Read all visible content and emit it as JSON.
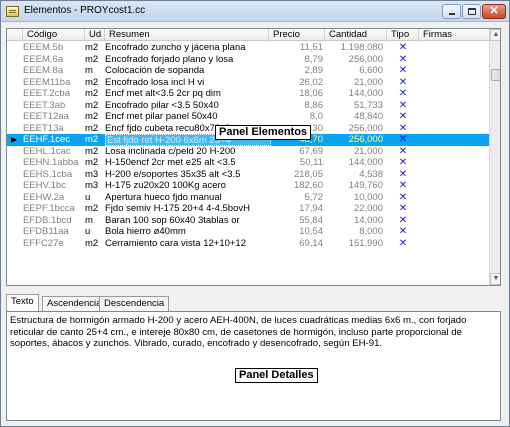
{
  "window": {
    "title": "Elementos - PROYcost1.cc",
    "icon": "document-list-icon"
  },
  "grid": {
    "columns": [
      "Código",
      "Ud",
      "Resumen",
      "Precio",
      "Cantidad",
      "Tipo",
      "Firmas"
    ],
    "rows": [
      {
        "code": "EEEM.5b",
        "ud": "m2",
        "resumen": "Encofrado zuncho y jácena plana",
        "precio": "11,51",
        "cantidad": "1.198,080",
        "tipo": "✕"
      },
      {
        "code": "EEEM.6a",
        "ud": "m2",
        "resumen": "Encofrado forjado plano y losa",
        "precio": "8,79",
        "cantidad": "256,000",
        "tipo": "✕"
      },
      {
        "code": "EEEM.8a",
        "ud": "m",
        "resumen": "Colocación de sopanda",
        "precio": "2,89",
        "cantidad": "6,600",
        "tipo": "✕"
      },
      {
        "code": "EEEM11ba",
        "ud": "m2",
        "resumen": "Encofrado losa incl H vi",
        "precio": "26,02",
        "cantidad": "21,000",
        "tipo": "✕"
      },
      {
        "code": "EEET.2cba",
        "ud": "m2",
        "resumen": "Encf met alt<3.5 2cr pq dim",
        "precio": "18,06",
        "cantidad": "144,000",
        "tipo": "✕"
      },
      {
        "code": "EEET.3ab",
        "ud": "m2",
        "resumen": "Encofrado pilar <3.5 50x40",
        "precio": "8,86",
        "cantidad": "51,733",
        "tipo": "✕"
      },
      {
        "code": "EEET12aa",
        "ud": "m2",
        "resumen": "Encf met pilar panel 50x40",
        "precio": "8,0",
        "cantidad": "48,840",
        "tipo": "✕"
      },
      {
        "code": "EEET13a",
        "ud": "m2",
        "resumen": "Encf fjdo cubeta recu80x76x2",
        "precio": "30",
        "cantidad": "256,000",
        "tipo": "✕"
      },
      {
        "code": "EEHF.1cec",
        "ud": "m2",
        "resumen": "Est fjdo ret H-200 6x6m 25+4",
        "precio": "43,70",
        "cantidad": "256,000",
        "tipo": "✕",
        "selected": true
      },
      {
        "code": "EEHL.1cac",
        "ud": "m2",
        "resumen": "Losa inclinada c/peld 20 H-200",
        "precio": "67,69",
        "cantidad": "21,000",
        "tipo": "✕"
      },
      {
        "code": "EEHN.1abba",
        "ud": "m2",
        "resumen": "H-150encf 2cr met e25 alt <3.5",
        "precio": "50,11",
        "cantidad": "144,000",
        "tipo": "✕"
      },
      {
        "code": "EEHS.1cba",
        "ud": "m3",
        "resumen": "H-200 e/soportes 35x35 alt <3.5",
        "precio": "218,05",
        "cantidad": "4,538",
        "tipo": "✕"
      },
      {
        "code": "EEHV.1bc",
        "ud": "m3",
        "resumen": "H-175 zu20x20 100Kg acero",
        "precio": "182,60",
        "cantidad": "149,760",
        "tipo": "✕"
      },
      {
        "code": "EEHW.2a",
        "ud": "u",
        "resumen": "Apertura hueco fjdo manual",
        "precio": "5,72",
        "cantidad": "10,000",
        "tipo": "✕"
      },
      {
        "code": "EEPF.1bcca",
        "ud": "m2",
        "resumen": "Fjdo semiv H-175 20+4 4-4.5bovH",
        "precio": "17,94",
        "cantidad": "22,000",
        "tipo": "✕"
      },
      {
        "code": "EFDB.1bcd",
        "ud": "m",
        "resumen": "Baran 100 sop 60x40 3tablas or",
        "precio": "55,84",
        "cantidad": "14,000",
        "tipo": "✕"
      },
      {
        "code": "EFDB11aa",
        "ud": "u",
        "resumen": "Bola hierro ø40mm",
        "precio": "10,54",
        "cantidad": "8,000",
        "tipo": "✕"
      },
      {
        "code": "EFFC27e",
        "ud": "m2",
        "resumen": "Cerramiento cara vista 12+10+12",
        "precio": "69,14",
        "cantidad": "151,990",
        "tipo": "✕"
      }
    ],
    "row_indicator": "▶"
  },
  "labels": {
    "panel_elementos": "Panel Elementos",
    "panel_detalles": "Panel Detalles"
  },
  "tabs": [
    {
      "label": "Texto",
      "active": true
    },
    {
      "label": "Ascendencia"
    },
    {
      "label": "Descendencia"
    }
  ],
  "detail": {
    "text": "Estructura de hormigón armado H-200 y acero AEH-400N, de luces cuadráticas medias 6x6 m., con forjado reticular de canto 25+4 cm., e intereje 80x80 cm, de casetones de hormigón, incluso parte proporcional de soportes, ábacos y zunchos. Vibrado, curado, encofrado y desencofrado, según EH-91."
  },
  "colors": {
    "selection": "#0aa3f2",
    "tipo_mark": "#1a1ad0"
  }
}
